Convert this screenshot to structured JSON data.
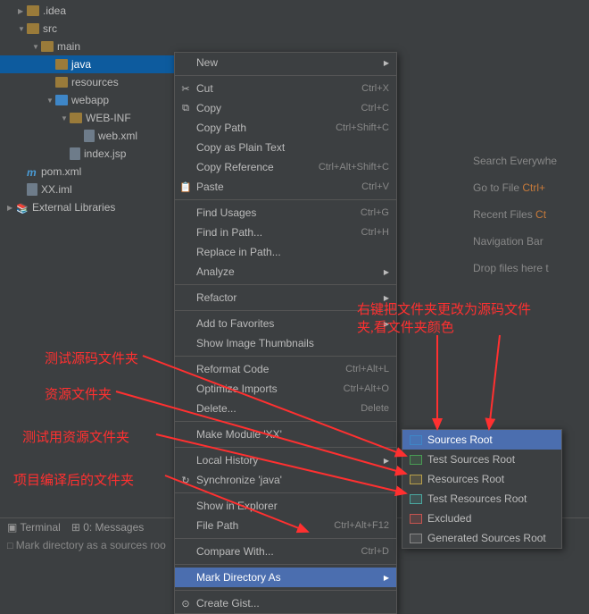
{
  "tree": {
    "idea": ".idea",
    "src": "src",
    "main": "main",
    "java": "java",
    "resources": "resources",
    "webapp": "webapp",
    "webinf": "WEB-INF",
    "webxml": "web.xml",
    "indexjsp": "index.jsp",
    "pom": "pom.xml",
    "iml": "XX.iml",
    "extlib": "External Libraries"
  },
  "menu": {
    "new": "New",
    "cut": "Cut",
    "cut_k": "Ctrl+X",
    "copy": "Copy",
    "copy_k": "Ctrl+C",
    "copypath": "Copy Path",
    "copypath_k": "Ctrl+Shift+C",
    "copyplain": "Copy as Plain Text",
    "copyref": "Copy Reference",
    "copyref_k": "Ctrl+Alt+Shift+C",
    "paste": "Paste",
    "paste_k": "Ctrl+V",
    "findusages": "Find Usages",
    "findusages_k": "Ctrl+G",
    "findinpath": "Find in Path...",
    "findinpath_k": "Ctrl+H",
    "replaceinpath": "Replace in Path...",
    "analyze": "Analyze",
    "refactor": "Refactor",
    "addfav": "Add to Favorites",
    "showthumb": "Show Image Thumbnails",
    "reformat": "Reformat Code",
    "reformat_k": "Ctrl+Alt+L",
    "optimize": "Optimize Imports",
    "optimize_k": "Ctrl+Alt+O",
    "delete": "Delete...",
    "delete_k": "Delete",
    "makemodule": "Make Module 'XX'",
    "localhist": "Local History",
    "sync": "Synchronize 'java'",
    "showexp": "Show in Explorer",
    "filepath": "File Path",
    "filepath_k": "Ctrl+Alt+F12",
    "compare": "Compare With...",
    "compare_k": "Ctrl+D",
    "markdir": "Mark Directory As",
    "gist": "Create Gist..."
  },
  "submenu": {
    "sources": "Sources Root",
    "testsources": "Test Sources Root",
    "resources": "Resources Root",
    "testresources": "Test Resources Root",
    "excluded": "Excluded",
    "generated": "Generated Sources Root"
  },
  "hints": {
    "search": "Search Everywhe",
    "gotofile": "Go to File ",
    "gotofile_k": "Ctrl+",
    "recent": "Recent Files ",
    "recent_k": "Ct",
    "navbar": "Navigation Bar",
    "drop": "Drop files here t"
  },
  "annotations": {
    "a1": "右键把文件夹更改为源码文件",
    "a1b": "夹,看文件夹颜色",
    "a2": "测试源码文件夹",
    "a3": "资源文件夹",
    "a4": "测试用资源文件夹",
    "a5": "项目编译后的文件夹"
  },
  "bottom": {
    "terminal": "Terminal",
    "messages": "0: Messages",
    "status": "Mark directory as a sources roo"
  }
}
